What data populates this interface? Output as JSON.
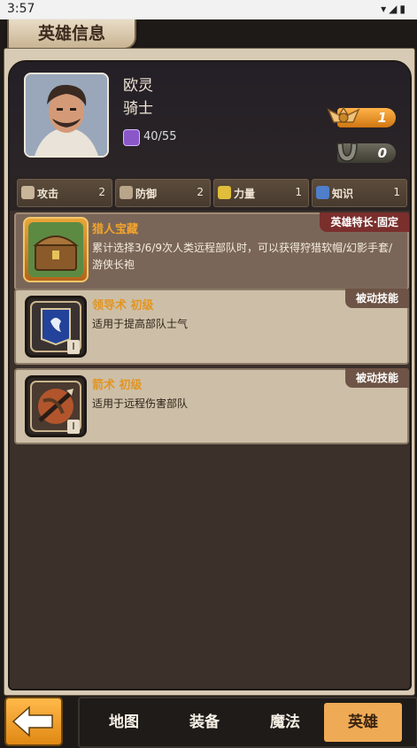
{
  "status_bar": {
    "time": "3:57",
    "icons": [
      "wifi-icon",
      "signal-icon",
      "battery-icon"
    ]
  },
  "page": {
    "title": "英雄信息"
  },
  "hero": {
    "name": "欧灵",
    "class": "骑士",
    "exp": "40/55",
    "rank_level": "1",
    "mount_level": "0"
  },
  "stats": [
    {
      "label": "攻击",
      "value": "2",
      "icon": "sword-icon"
    },
    {
      "label": "防御",
      "value": "2",
      "icon": "shield-icon"
    },
    {
      "label": "力量",
      "value": "1",
      "icon": "fist-icon"
    },
    {
      "label": "知识",
      "value": "1",
      "icon": "book-icon"
    }
  ],
  "specialty": {
    "tag": "英雄特长·固定",
    "title": "猎人宝藏",
    "description": "累计选择3/6/9次人类远程部队时，可以获得狩猎软帽/幻影手套/游侠长袍",
    "icon": "treasure-chest-icon"
  },
  "skills": [
    {
      "tag": "被动技能",
      "title": "领导术 初级",
      "description": "适用于提高部队士气",
      "level": "I",
      "icon": "banner-icon"
    },
    {
      "tag": "被动技能",
      "title": "箭术 初级",
      "description": "适用于远程伤害部队",
      "level": "I",
      "icon": "crossbow-icon"
    }
  ],
  "nav": {
    "back_icon": "back-arrow-icon",
    "items": [
      {
        "label": "地图"
      },
      {
        "label": "装备"
      },
      {
        "label": "魔法"
      },
      {
        "label": "英雄",
        "active": true
      }
    ]
  },
  "colors": {
    "accent": "#eeaa55",
    "frame": "#d8cbb5",
    "panel": "#3b302a",
    "title_orange": "#f3a42c",
    "tag_red": "#7a2f2d"
  }
}
